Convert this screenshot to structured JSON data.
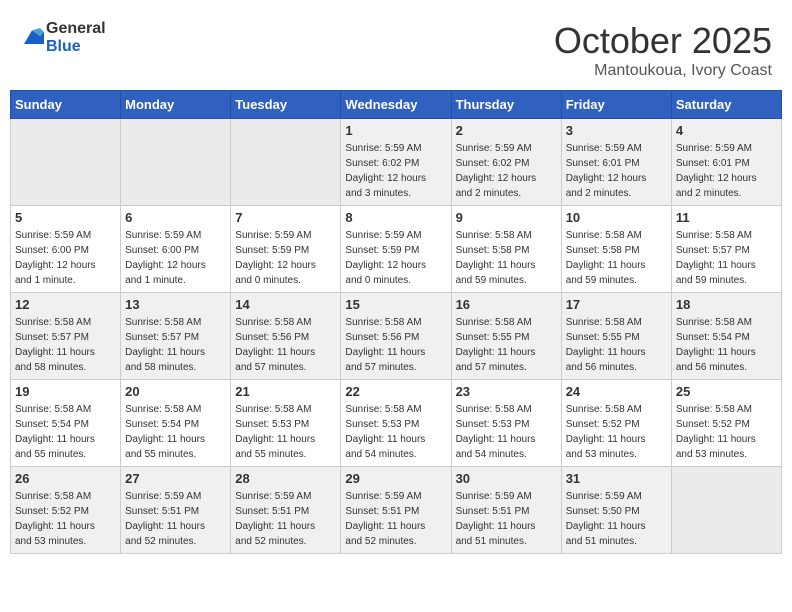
{
  "header": {
    "logo_line1": "General",
    "logo_line2": "Blue",
    "month": "October 2025",
    "location": "Mantoukoua, Ivory Coast"
  },
  "weekdays": [
    "Sunday",
    "Monday",
    "Tuesday",
    "Wednesday",
    "Thursday",
    "Friday",
    "Saturday"
  ],
  "weeks": [
    [
      {
        "day": "",
        "info": ""
      },
      {
        "day": "",
        "info": ""
      },
      {
        "day": "",
        "info": ""
      },
      {
        "day": "1",
        "info": "Sunrise: 5:59 AM\nSunset: 6:02 PM\nDaylight: 12 hours\nand 3 minutes."
      },
      {
        "day": "2",
        "info": "Sunrise: 5:59 AM\nSunset: 6:02 PM\nDaylight: 12 hours\nand 2 minutes."
      },
      {
        "day": "3",
        "info": "Sunrise: 5:59 AM\nSunset: 6:01 PM\nDaylight: 12 hours\nand 2 minutes."
      },
      {
        "day": "4",
        "info": "Sunrise: 5:59 AM\nSunset: 6:01 PM\nDaylight: 12 hours\nand 2 minutes."
      }
    ],
    [
      {
        "day": "5",
        "info": "Sunrise: 5:59 AM\nSunset: 6:00 PM\nDaylight: 12 hours\nand 1 minute."
      },
      {
        "day": "6",
        "info": "Sunrise: 5:59 AM\nSunset: 6:00 PM\nDaylight: 12 hours\nand 1 minute."
      },
      {
        "day": "7",
        "info": "Sunrise: 5:59 AM\nSunset: 5:59 PM\nDaylight: 12 hours\nand 0 minutes."
      },
      {
        "day": "8",
        "info": "Sunrise: 5:59 AM\nSunset: 5:59 PM\nDaylight: 12 hours\nand 0 minutes."
      },
      {
        "day": "9",
        "info": "Sunrise: 5:58 AM\nSunset: 5:58 PM\nDaylight: 11 hours\nand 59 minutes."
      },
      {
        "day": "10",
        "info": "Sunrise: 5:58 AM\nSunset: 5:58 PM\nDaylight: 11 hours\nand 59 minutes."
      },
      {
        "day": "11",
        "info": "Sunrise: 5:58 AM\nSunset: 5:57 PM\nDaylight: 11 hours\nand 59 minutes."
      }
    ],
    [
      {
        "day": "12",
        "info": "Sunrise: 5:58 AM\nSunset: 5:57 PM\nDaylight: 11 hours\nand 58 minutes."
      },
      {
        "day": "13",
        "info": "Sunrise: 5:58 AM\nSunset: 5:57 PM\nDaylight: 11 hours\nand 58 minutes."
      },
      {
        "day": "14",
        "info": "Sunrise: 5:58 AM\nSunset: 5:56 PM\nDaylight: 11 hours\nand 57 minutes."
      },
      {
        "day": "15",
        "info": "Sunrise: 5:58 AM\nSunset: 5:56 PM\nDaylight: 11 hours\nand 57 minutes."
      },
      {
        "day": "16",
        "info": "Sunrise: 5:58 AM\nSunset: 5:55 PM\nDaylight: 11 hours\nand 57 minutes."
      },
      {
        "day": "17",
        "info": "Sunrise: 5:58 AM\nSunset: 5:55 PM\nDaylight: 11 hours\nand 56 minutes."
      },
      {
        "day": "18",
        "info": "Sunrise: 5:58 AM\nSunset: 5:54 PM\nDaylight: 11 hours\nand 56 minutes."
      }
    ],
    [
      {
        "day": "19",
        "info": "Sunrise: 5:58 AM\nSunset: 5:54 PM\nDaylight: 11 hours\nand 55 minutes."
      },
      {
        "day": "20",
        "info": "Sunrise: 5:58 AM\nSunset: 5:54 PM\nDaylight: 11 hours\nand 55 minutes."
      },
      {
        "day": "21",
        "info": "Sunrise: 5:58 AM\nSunset: 5:53 PM\nDaylight: 11 hours\nand 55 minutes."
      },
      {
        "day": "22",
        "info": "Sunrise: 5:58 AM\nSunset: 5:53 PM\nDaylight: 11 hours\nand 54 minutes."
      },
      {
        "day": "23",
        "info": "Sunrise: 5:58 AM\nSunset: 5:53 PM\nDaylight: 11 hours\nand 54 minutes."
      },
      {
        "day": "24",
        "info": "Sunrise: 5:58 AM\nSunset: 5:52 PM\nDaylight: 11 hours\nand 53 minutes."
      },
      {
        "day": "25",
        "info": "Sunrise: 5:58 AM\nSunset: 5:52 PM\nDaylight: 11 hours\nand 53 minutes."
      }
    ],
    [
      {
        "day": "26",
        "info": "Sunrise: 5:58 AM\nSunset: 5:52 PM\nDaylight: 11 hours\nand 53 minutes."
      },
      {
        "day": "27",
        "info": "Sunrise: 5:59 AM\nSunset: 5:51 PM\nDaylight: 11 hours\nand 52 minutes."
      },
      {
        "day": "28",
        "info": "Sunrise: 5:59 AM\nSunset: 5:51 PM\nDaylight: 11 hours\nand 52 minutes."
      },
      {
        "day": "29",
        "info": "Sunrise: 5:59 AM\nSunset: 5:51 PM\nDaylight: 11 hours\nand 52 minutes."
      },
      {
        "day": "30",
        "info": "Sunrise: 5:59 AM\nSunset: 5:51 PM\nDaylight: 11 hours\nand 51 minutes."
      },
      {
        "day": "31",
        "info": "Sunrise: 5:59 AM\nSunset: 5:50 PM\nDaylight: 11 hours\nand 51 minutes."
      },
      {
        "day": "",
        "info": ""
      }
    ]
  ]
}
